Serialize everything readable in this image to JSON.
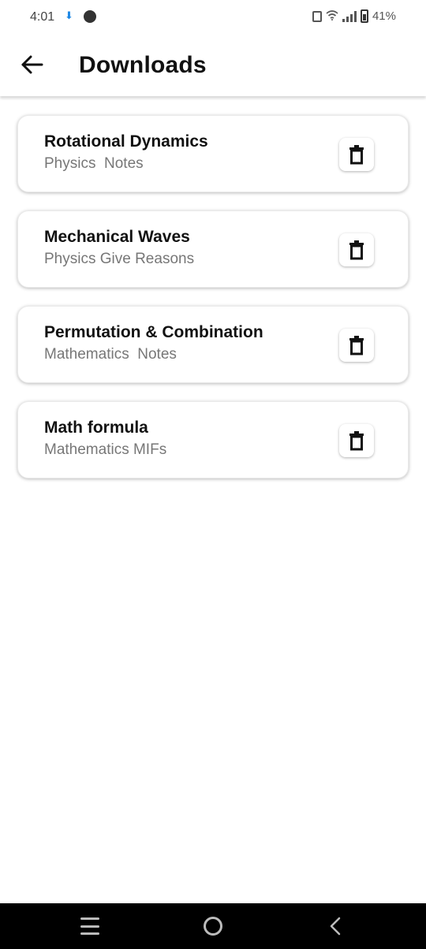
{
  "status_bar": {
    "time": "4:01",
    "battery": "41%",
    "icons": [
      "download-icon",
      "app-icon",
      "vibrate-icon",
      "wifi-icon",
      "signal-icon",
      "battery-icon"
    ]
  },
  "header": {
    "title": "Downloads",
    "back_icon": "arrow-left-icon"
  },
  "downloads": [
    {
      "title": "Rotational Dynamics",
      "subtitle": "Physics  Notes"
    },
    {
      "title": "Mechanical Waves",
      "subtitle": "Physics Give Reasons"
    },
    {
      "title": "Permutation & Combination",
      "subtitle": "Mathematics  Notes"
    },
    {
      "title": "Math formula",
      "subtitle": "Mathematics MIFs"
    }
  ],
  "nav_bar": {
    "icons": [
      "recents-icon",
      "home-icon",
      "back-icon"
    ]
  }
}
